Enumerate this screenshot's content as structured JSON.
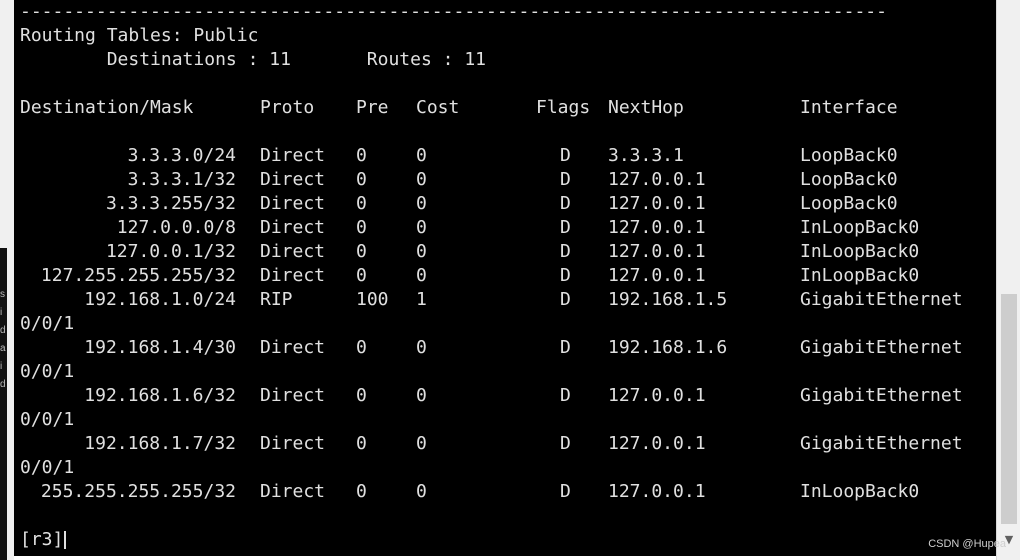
{
  "terminal": {
    "separator": "--------------------------------------------------------------------------------",
    "table_title": "Routing Tables: Public",
    "summary": "        Destinations : 11       Routes : 11",
    "columns": [
      "Destination/Mask",
      "Proto",
      "Pre",
      "Cost",
      "Flags",
      "NextHop",
      "Interface"
    ],
    "routes": [
      {
        "dest": "3.3.3.0/24",
        "proto": "Direct",
        "pre": "0",
        "cost": "0",
        "flags": "D",
        "nexthop": "3.3.3.1",
        "iface": "LoopBack0",
        "iface_wrap": ""
      },
      {
        "dest": "3.3.3.1/32",
        "proto": "Direct",
        "pre": "0",
        "cost": "0",
        "flags": "D",
        "nexthop": "127.0.0.1",
        "iface": "LoopBack0",
        "iface_wrap": ""
      },
      {
        "dest": "3.3.3.255/32",
        "proto": "Direct",
        "pre": "0",
        "cost": "0",
        "flags": "D",
        "nexthop": "127.0.0.1",
        "iface": "LoopBack0",
        "iface_wrap": ""
      },
      {
        "dest": "127.0.0.0/8",
        "proto": "Direct",
        "pre": "0",
        "cost": "0",
        "flags": "D",
        "nexthop": "127.0.0.1",
        "iface": "InLoopBack0",
        "iface_wrap": ""
      },
      {
        "dest": "127.0.0.1/32",
        "proto": "Direct",
        "pre": "0",
        "cost": "0",
        "flags": "D",
        "nexthop": "127.0.0.1",
        "iface": "InLoopBack0",
        "iface_wrap": ""
      },
      {
        "dest": "127.255.255.255/32",
        "proto": "Direct",
        "pre": "0",
        "cost": "0",
        "flags": "D",
        "nexthop": "127.0.0.1",
        "iface": "InLoopBack0",
        "iface_wrap": ""
      },
      {
        "dest": "192.168.1.0/24",
        "proto": "RIP",
        "pre": "100",
        "cost": "1",
        "flags": "D",
        "nexthop": "192.168.1.5",
        "iface": "GigabitEthernet",
        "iface_wrap": "0/0/1"
      },
      {
        "dest": "192.168.1.4/30",
        "proto": "Direct",
        "pre": "0",
        "cost": "0",
        "flags": "D",
        "nexthop": "192.168.1.6",
        "iface": "GigabitEthernet",
        "iface_wrap": "0/0/1"
      },
      {
        "dest": "192.168.1.6/32",
        "proto": "Direct",
        "pre": "0",
        "cost": "0",
        "flags": "D",
        "nexthop": "127.0.0.1",
        "iface": "GigabitEthernet",
        "iface_wrap": "0/0/1"
      },
      {
        "dest": "192.168.1.7/32",
        "proto": "Direct",
        "pre": "0",
        "cost": "0",
        "flags": "D",
        "nexthop": "127.0.0.1",
        "iface": "GigabitEthernet",
        "iface_wrap": "0/0/1"
      },
      {
        "dest": "255.255.255.255/32",
        "proto": "Direct",
        "pre": "0",
        "cost": "0",
        "flags": "D",
        "nexthop": "127.0.0.1",
        "iface": "InLoopBack0",
        "iface_wrap": ""
      }
    ],
    "prompt": "[r3]"
  },
  "left_edge_chars": [
    "s",
    "i",
    "d",
    "a",
    "i",
    "d"
  ],
  "watermark": "CSDN @Hupea",
  "colors": {
    "terminal_bg": "#000000",
    "terminal_text": "#e0e0e0",
    "scrollbar_bg": "#f0f0f0",
    "scroll_thumb": "#cdcdcd"
  }
}
